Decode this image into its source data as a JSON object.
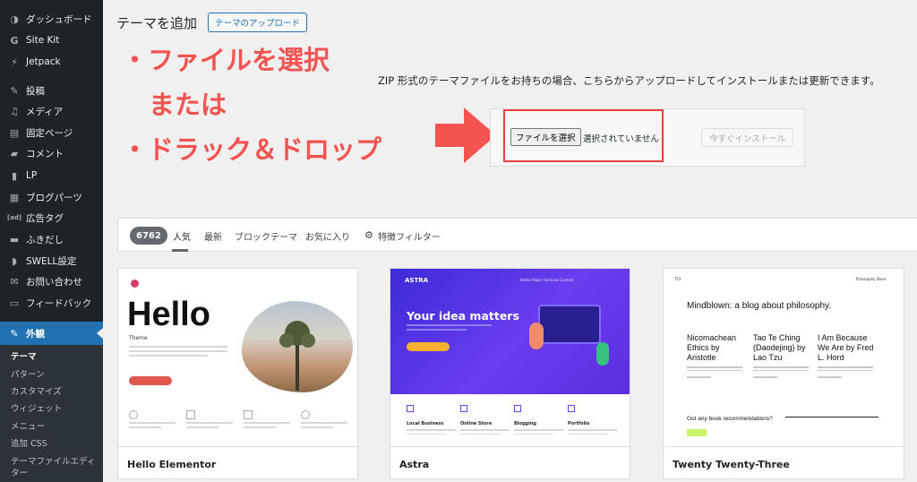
{
  "sidebar": {
    "items": [
      {
        "label": "ダッシュボード",
        "icon": "dashboard-icon",
        "glyph": "◑"
      },
      {
        "label": "Site Kit",
        "icon": "google-g-icon",
        "glyph": "G"
      },
      {
        "label": "Jetpack",
        "icon": "jetpack-icon",
        "glyph": "⚡"
      },
      {
        "label": "投稿",
        "icon": "pin-icon",
        "glyph": "✎"
      },
      {
        "label": "メディア",
        "icon": "media-icon",
        "glyph": "♫"
      },
      {
        "label": "固定ページ",
        "icon": "page-icon",
        "glyph": "▤"
      },
      {
        "label": "コメント",
        "icon": "comment-icon",
        "glyph": "▰"
      },
      {
        "label": "LP",
        "icon": "lp-icon",
        "glyph": "▮"
      },
      {
        "label": "ブログパーツ",
        "icon": "block-icon",
        "glyph": "▦"
      },
      {
        "label": "広告タグ",
        "icon": "ad-icon",
        "glyph": "[ad]"
      },
      {
        "label": "ふきだし",
        "icon": "speech-bubble-icon",
        "glyph": "▬"
      },
      {
        "label": "SWELL設定",
        "icon": "swell-icon",
        "glyph": "◗"
      },
      {
        "label": "お問い合わせ",
        "icon": "mail-icon",
        "glyph": "✉"
      },
      {
        "label": "フィードバック",
        "icon": "feedback-icon",
        "glyph": "▭"
      }
    ],
    "active_item": {
      "label": "外観",
      "icon": "appearance-icon",
      "glyph": "✎"
    },
    "submenu": [
      "テーマ",
      "パターン",
      "カスタマイズ",
      "ウィジェット",
      "メニュー",
      "追加 CSS",
      "テーマファイルエディ",
      "ター"
    ]
  },
  "header": {
    "title": "テーマを追加",
    "upload_button": "テーマのアップロード"
  },
  "annotation": {
    "line1": "・ファイルを選択",
    "line2": "または",
    "line3": "・ドラック＆ドロップ",
    "color": "#f5534f"
  },
  "upload": {
    "description": "ZIP 形式のテーマファイルをお持ちの場合、こちらからアップロードしてインストールまたは更新できます。",
    "file_button": "ファイルを選択",
    "no_file": "選択されていません",
    "install_button": "今すぐインストール"
  },
  "filter": {
    "count": "6762",
    "tabs": [
      "人気",
      "最新",
      "ブロックテーマ",
      "お気に入り"
    ],
    "feature_filter": "特徴フィルター"
  },
  "themes": [
    {
      "name": "Hello Elementor",
      "preview": {
        "heading": "Hello",
        "subheading": "Theme"
      }
    },
    {
      "name": "Astra",
      "preview": {
        "logo": "ASTRA",
        "nav": "Home   Pages   Services   Contact",
        "heading": "Your idea matters",
        "features": [
          "Local Business",
          "Online Store",
          "Blogging",
          "Portfolio"
        ]
      }
    },
    {
      "name": "Twenty Twenty-Three",
      "preview": {
        "site": "TT3",
        "nav": "Philosophy   Store",
        "heading": "Mindblown: a blog about philosophy.",
        "posts": [
          "Nicomachean Ethics by Aristotle",
          "Tao Te Ching (Daodejing) by Lao Tzu",
          "I Am Because We Are by Fred L. Hord"
        ],
        "question": "Got any book recommendations?"
      }
    }
  ]
}
